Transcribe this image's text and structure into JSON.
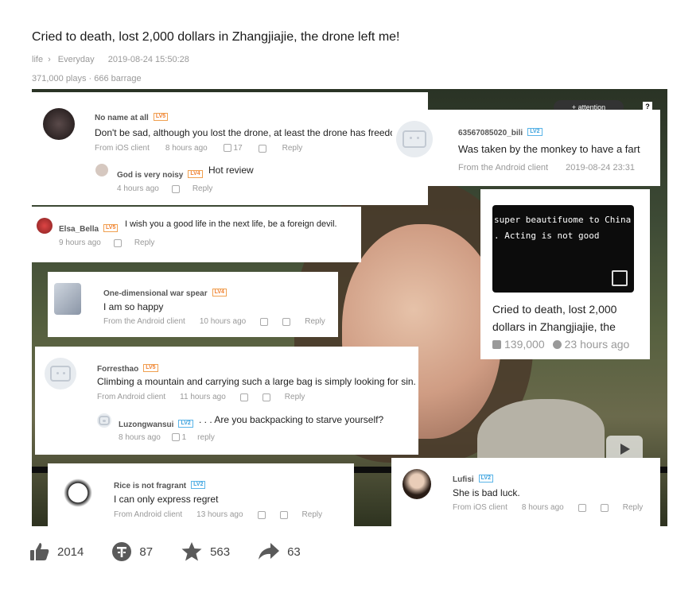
{
  "page": {
    "title": "Cried to death, lost 2,000 dollars in Zhangjiajie, the drone left me!",
    "category": "life",
    "subcategory": "Everyday",
    "datetime": "2019-08-24 15:50:28",
    "stats": "371,000 plays · 666 barrage"
  },
  "video": {
    "attention": "+ attention",
    "help": "?"
  },
  "comments": [
    {
      "user": "No name at all",
      "level": "LV5",
      "text": "Don't be sad, although you lost the drone, at least the drone has freedom.",
      "client": "From iOS client",
      "time": "8 hours ago",
      "likes": "17",
      "reply": "Reply"
    },
    {
      "user": "God is very noisy",
      "level": "LV4",
      "text": "Hot review",
      "time": "4 hours ago",
      "reply": "Reply"
    },
    {
      "user": "63567085020_bili",
      "level": "LV2",
      "text": "Was taken by the monkey to have a fart",
      "client": "From the Android client",
      "time": "2019-08-24 23:31"
    },
    {
      "user": "Elsa_Bella",
      "level": "LV5",
      "text": "I wish you a good life in the next life, be a foreign devil.",
      "time": "9 hours ago",
      "reply": "Reply"
    },
    {
      "user": "One-dimensional war spear",
      "level": "LV4",
      "text": "I am so happy",
      "client": "From the Android client",
      "time": "10 hours ago",
      "reply": "Reply"
    },
    {
      "user": "Forresthao",
      "level": "LV5",
      "text": "Climbing a mountain and carrying such a large bag is simply looking for sin.",
      "client": "From Android client",
      "time": "11 hours ago",
      "reply": "Reply"
    },
    {
      "user": "Luzongwansui",
      "level": "LV2",
      "text": ". . . Are you backpacking to starve yourself?",
      "time": "8 hours ago",
      "likes": "1",
      "reply": "reply"
    },
    {
      "user": "Rice is not fragrant",
      "level": "LV2",
      "text": "I can only express regret",
      "client": "From Android client",
      "time": "13 hours ago",
      "reply": "Reply"
    },
    {
      "user": "Lufisi",
      "level": "LV2",
      "text": "She is bad luck.",
      "client": "From iOS client",
      "time": "8 hours ago",
      "reply": "Reply"
    }
  ],
  "related": {
    "overlay_line1": "super beautifuome to China",
    "overlay_line2": ".   Acting is not good",
    "title": "Cried to death, lost 2,000 dollars in Zhangjiajie, the",
    "plays": "139,000",
    "time": "23 hours ago"
  },
  "actions": {
    "likes": "2014",
    "coins": "87",
    "favorites": "563",
    "shares": "63"
  },
  "colors": {
    "level_orange": "#f08030",
    "level_blue": "#3aa0dc",
    "text_grey": "#999999"
  }
}
